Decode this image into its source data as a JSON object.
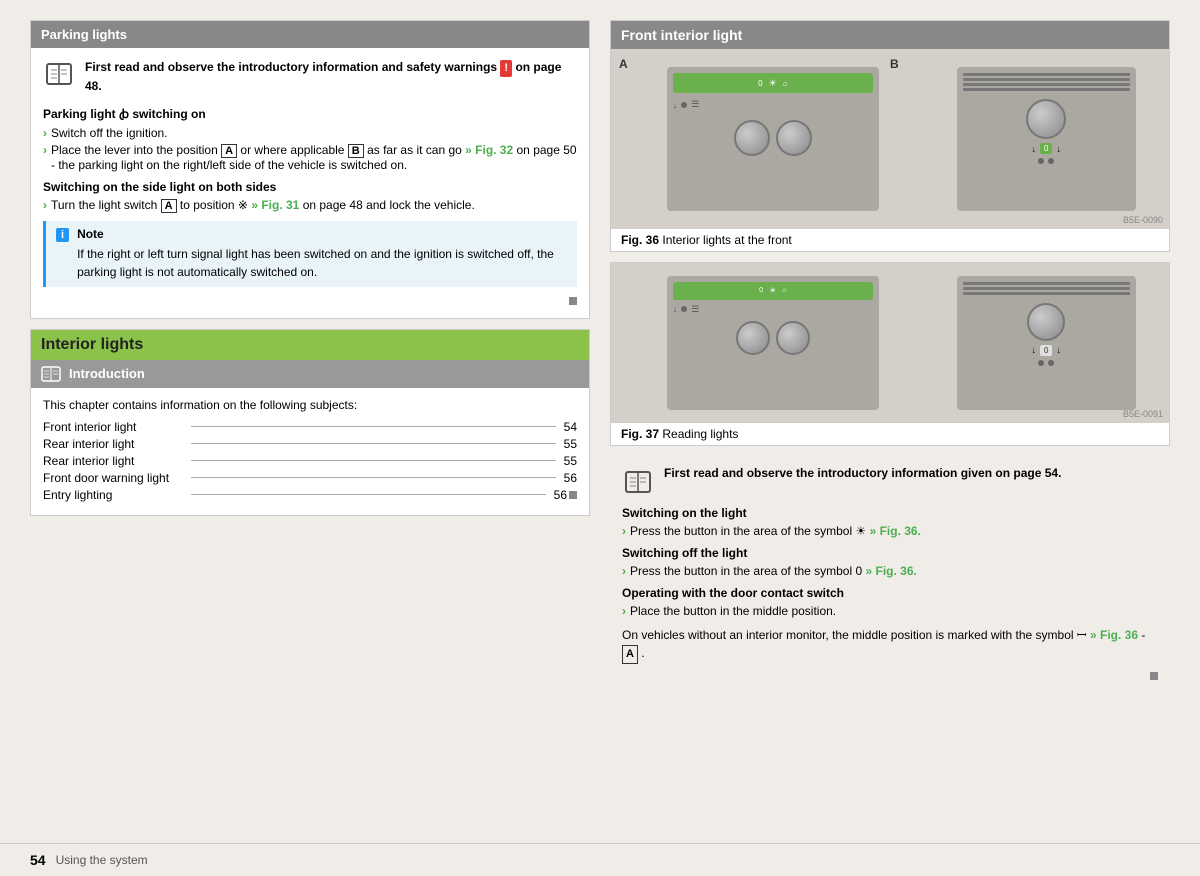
{
  "page": {
    "footer": {
      "page_number": "54",
      "section_label": "Using the system"
    }
  },
  "left": {
    "parking_section": {
      "header": "Parking lights",
      "warning": {
        "text": "First read and observe the introductory information and safety warnings",
        "page_ref": "on page 48.",
        "red_badge": "!"
      },
      "parking_heading": "Parking light ꞗ switching on",
      "steps": [
        "Switch off the ignition.",
        "Place the lever into the position A or where applicable B as far as it can go » Fig. 32 on page 50 - the parking light on the right/left side of the vehicle is switched on."
      ],
      "side_heading": "Switching on the side light on both sides",
      "side_step": "Turn the light switch A to position ※ » Fig. 31 on page 48 and lock the vehicle.",
      "note_heading": "Note",
      "note_text": "If the right or left turn signal light has been switched on and the ignition is switched off, the parking light is not automatically switched on."
    },
    "interior_section": {
      "header": "Interior lights",
      "intro_header": "Introduction",
      "intro_text": "This chapter contains information on the following subjects:",
      "toc": [
        {
          "label": "Front interior light",
          "page": "54"
        },
        {
          "label": "Rear interior light",
          "page": "55"
        },
        {
          "label": "Rear interior light",
          "page": "55"
        },
        {
          "label": "Front door warning light",
          "page": "56"
        },
        {
          "label": "Entry lighting",
          "page": "56"
        }
      ]
    }
  },
  "right": {
    "front_light_section": {
      "header": "Front interior light",
      "fig36_caption": "Fig. 36",
      "fig36_label": "Interior lights at the front",
      "fig37_caption": "Fig. 37",
      "fig37_label": "Reading lights",
      "bse_0090": "B5E-0090",
      "bse_0091": "B5E-0091",
      "label_a": "A",
      "label_b": "B"
    },
    "content": {
      "intro_text": "First read and observe the introductory information given on page 54.",
      "switch_on_heading": "Switching on the light",
      "switch_on_step": "Press the button in the area of the symbol ☀ » Fig. 36.",
      "switch_off_heading": "Switching off the light",
      "switch_off_step": "Press the button in the area of the symbol 0 » Fig. 36.",
      "door_heading": "Operating with the door contact switch",
      "door_step": "Place the button in the middle position.",
      "extra_text": "On vehicles without an interior monitor, the middle position is marked with the symbol ꟷ » Fig. 36 - A ."
    }
  }
}
